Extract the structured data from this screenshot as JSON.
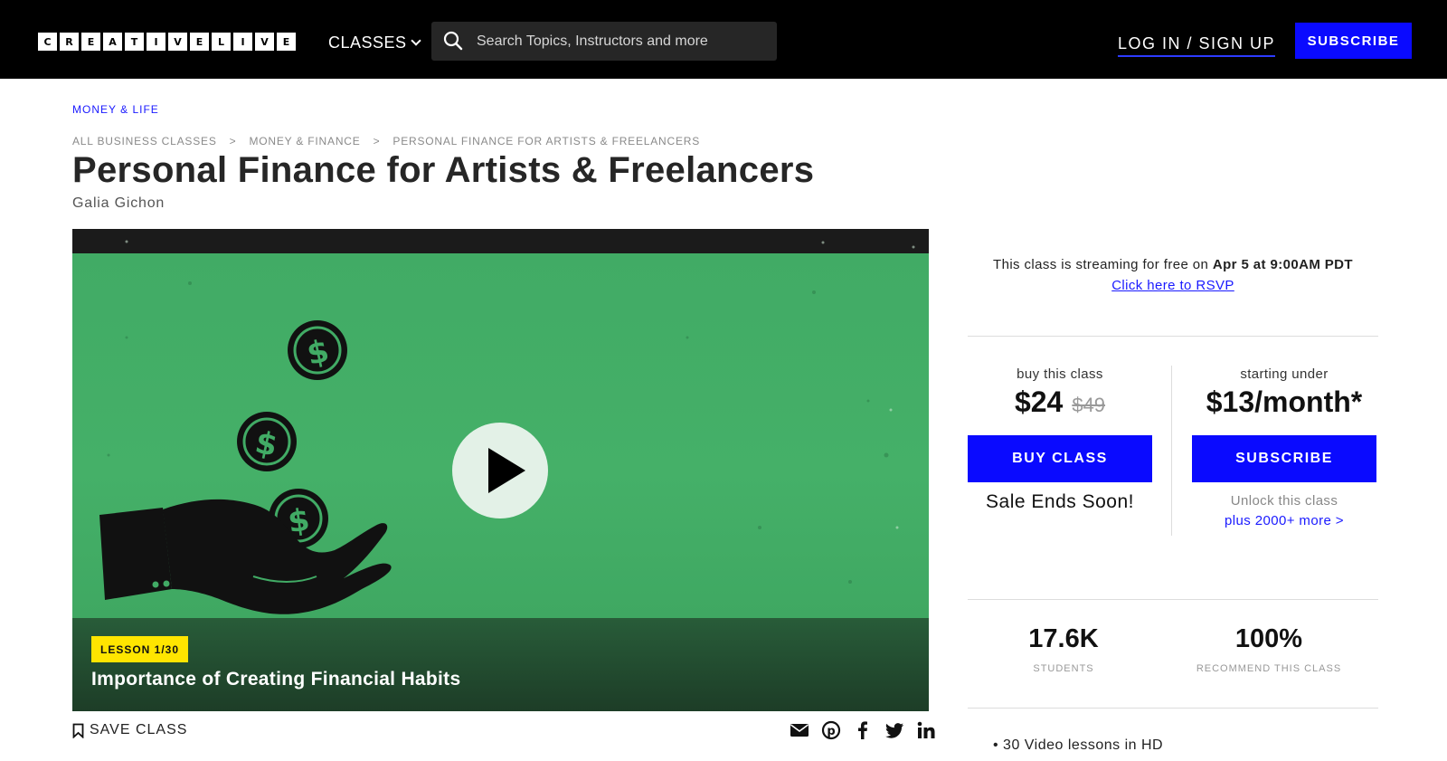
{
  "header": {
    "logo_letters": [
      "C",
      "R",
      "E",
      "A",
      "T",
      "I",
      "V",
      "E",
      "L",
      "I",
      "V",
      "E"
    ],
    "classes_label": "CLASSES",
    "search_placeholder": "Search Topics, Instructors and more",
    "login_label": "LOG IN / SIGN UP",
    "subscribe_label": "SUBSCRIBE"
  },
  "course": {
    "category": "MONEY & LIFE",
    "breadcrumbs": [
      "ALL BUSINESS CLASSES",
      "MONEY & FINANCE",
      "PERSONAL FINANCE FOR ARTISTS & FREELANCERS"
    ],
    "breadcrumb_separator": ">",
    "title": "Personal Finance for Artists & Freelancers",
    "author": "Galia Gichon"
  },
  "video": {
    "lesson_tag": "LESSON 1/30",
    "lesson_title": "Importance of Creating Financial Habits",
    "play_icon": "play-icon"
  },
  "actions": {
    "save_label": "SAVE CLASS",
    "share_icons": [
      "email-icon",
      "pinterest-icon",
      "facebook-icon",
      "twitter-icon",
      "linkedin-icon"
    ]
  },
  "sidebar": {
    "stream_prefix": "This class is streaming for free on ",
    "stream_date": "Apr 5 at 9:00AM PDT",
    "rsvp_label": "Click here to RSVP",
    "buy": {
      "label": "buy this class",
      "price": "$24",
      "old_price": "$49",
      "button": "BUY CLASS",
      "note": "Sale Ends Soon!"
    },
    "subscribe": {
      "label": "starting under",
      "price": "$13/month*",
      "button": "SUBSCRIBE",
      "note": "Unlock this class",
      "more_link": "plus 2000+ more >"
    },
    "stats": [
      {
        "value": "17.6K",
        "label": "STUDENTS"
      },
      {
        "value": "100%",
        "label": "RECOMMEND THIS CLASS"
      }
    ],
    "features": [
      "30 Video lessons in HD"
    ]
  },
  "colors": {
    "accent_blue": "#0a0aff",
    "video_green": "#41ab65",
    "lesson_tag_yellow": "#ffe500"
  }
}
